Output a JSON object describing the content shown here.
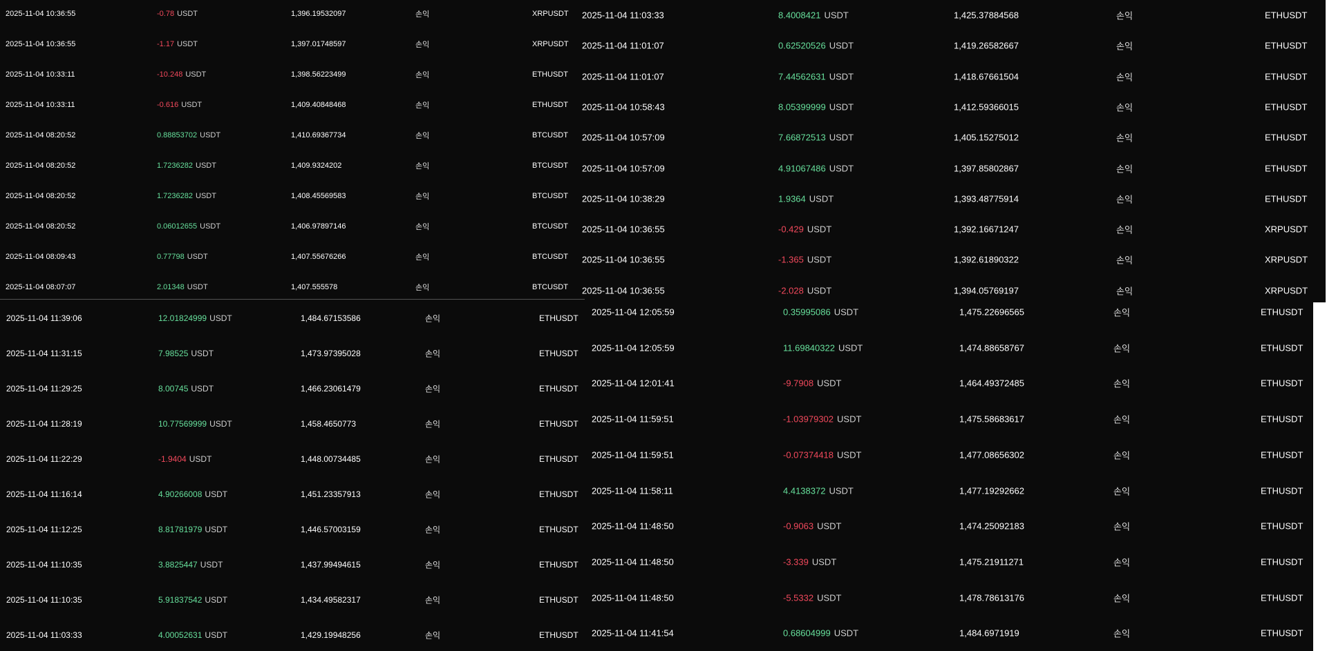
{
  "colors": {
    "background": "#0b0b0b",
    "profit": "#67e09c",
    "loss": "#f2495c",
    "text": "#ffffff"
  },
  "panels": [
    {
      "id": "top-left",
      "rows": [
        {
          "time": "2025-11-04 10:36:55",
          "amount": "-0.78",
          "unit": "USDT",
          "price": "1,396.19532097",
          "type": "손익",
          "symbol": "XRPUSDT"
        },
        {
          "time": "2025-11-04 10:36:55",
          "amount": "-1.17",
          "unit": "USDT",
          "price": "1,397.01748597",
          "type": "손익",
          "symbol": "XRPUSDT"
        },
        {
          "time": "2025-11-04 10:33:11",
          "amount": "-10.248",
          "unit": "USDT",
          "price": "1,398.56223499",
          "type": "손익",
          "symbol": "ETHUSDT"
        },
        {
          "time": "2025-11-04 10:33:11",
          "amount": "-0.616",
          "unit": "USDT",
          "price": "1,409.40848468",
          "type": "손익",
          "symbol": "ETHUSDT"
        },
        {
          "time": "2025-11-04 08:20:52",
          "amount": "0.88853702",
          "unit": "USDT",
          "price": "1,410.69367734",
          "type": "손익",
          "symbol": "BTCUSDT"
        },
        {
          "time": "2025-11-04 08:20:52",
          "amount": "1.7236282",
          "unit": "USDT",
          "price": "1,409.9324202",
          "type": "손익",
          "symbol": "BTCUSDT"
        },
        {
          "time": "2025-11-04 08:20:52",
          "amount": "1.7236282",
          "unit": "USDT",
          "price": "1,408.45569583",
          "type": "손익",
          "symbol": "BTCUSDT"
        },
        {
          "time": "2025-11-04 08:20:52",
          "amount": "0.06012655",
          "unit": "USDT",
          "price": "1,406.97897146",
          "type": "손익",
          "symbol": "BTCUSDT"
        },
        {
          "time": "2025-11-04 08:09:43",
          "amount": "0.77798",
          "unit": "USDT",
          "price": "1,407.55676266",
          "type": "손익",
          "symbol": "BTCUSDT"
        },
        {
          "time": "2025-11-04 08:07:07",
          "amount": "2.01348",
          "unit": "USDT",
          "price": "1,407.555578",
          "type": "손익",
          "symbol": "BTCUSDT"
        }
      ]
    },
    {
      "id": "top-right",
      "rows": [
        {
          "time": "2025-11-04 11:03:33",
          "amount": "8.4008421",
          "unit": "USDT",
          "price": "1,425.37884568",
          "type": "손익",
          "symbol": "ETHUSDT"
        },
        {
          "time": "2025-11-04 11:01:07",
          "amount": "0.62520526",
          "unit": "USDT",
          "price": "1,419.26582667",
          "type": "손익",
          "symbol": "ETHUSDT"
        },
        {
          "time": "2025-11-04 11:01:07",
          "amount": "7.44562631",
          "unit": "USDT",
          "price": "1,418.67661504",
          "type": "손익",
          "symbol": "ETHUSDT"
        },
        {
          "time": "2025-11-04 10:58:43",
          "amount": "8.05399999",
          "unit": "USDT",
          "price": "1,412.59366015",
          "type": "손익",
          "symbol": "ETHUSDT"
        },
        {
          "time": "2025-11-04 10:57:09",
          "amount": "7.66872513",
          "unit": "USDT",
          "price": "1,405.15275012",
          "type": "손익",
          "symbol": "ETHUSDT"
        },
        {
          "time": "2025-11-04 10:57:09",
          "amount": "4.91067486",
          "unit": "USDT",
          "price": "1,397.85802867",
          "type": "손익",
          "symbol": "ETHUSDT"
        },
        {
          "time": "2025-11-04 10:38:29",
          "amount": "1.9364",
          "unit": "USDT",
          "price": "1,393.48775914",
          "type": "손익",
          "symbol": "ETHUSDT"
        },
        {
          "time": "2025-11-04 10:36:55",
          "amount": "-0.429",
          "unit": "USDT",
          "price": "1,392.16671247",
          "type": "손익",
          "symbol": "XRPUSDT"
        },
        {
          "time": "2025-11-04 10:36:55",
          "amount": "-1.365",
          "unit": "USDT",
          "price": "1,392.61890322",
          "type": "손익",
          "symbol": "XRPUSDT"
        },
        {
          "time": "2025-11-04 10:36:55",
          "amount": "-2.028",
          "unit": "USDT",
          "price": "1,394.05769197",
          "type": "손익",
          "symbol": "XRPUSDT"
        }
      ]
    },
    {
      "id": "bottom-left",
      "rows": [
        {
          "time": "2025-11-04 11:39:06",
          "amount": "12.01824999",
          "unit": "USDT",
          "price": "1,484.67153586",
          "type": "손익",
          "symbol": "ETHUSDT"
        },
        {
          "time": "2025-11-04 11:31:15",
          "amount": "7.98525",
          "unit": "USDT",
          "price": "1,473.97395028",
          "type": "손익",
          "symbol": "ETHUSDT"
        },
        {
          "time": "2025-11-04 11:29:25",
          "amount": "8.00745",
          "unit": "USDT",
          "price": "1,466.23061479",
          "type": "손익",
          "symbol": "ETHUSDT"
        },
        {
          "time": "2025-11-04 11:28:19",
          "amount": "10.77569999",
          "unit": "USDT",
          "price": "1,458.4650773",
          "type": "손익",
          "symbol": "ETHUSDT"
        },
        {
          "time": "2025-11-04 11:22:29",
          "amount": "-1.9404",
          "unit": "USDT",
          "price": "1,448.00734485",
          "type": "손익",
          "symbol": "ETHUSDT"
        },
        {
          "time": "2025-11-04 11:16:14",
          "amount": "4.90266008",
          "unit": "USDT",
          "price": "1,451.23357913",
          "type": "손익",
          "symbol": "ETHUSDT"
        },
        {
          "time": "2025-11-04 11:12:25",
          "amount": "8.81781979",
          "unit": "USDT",
          "price": "1,446.57003159",
          "type": "손익",
          "symbol": "ETHUSDT"
        },
        {
          "time": "2025-11-04 11:10:35",
          "amount": "3.8825447",
          "unit": "USDT",
          "price": "1,437.99494615",
          "type": "손익",
          "symbol": "ETHUSDT"
        },
        {
          "time": "2025-11-04 11:10:35",
          "amount": "5.91837542",
          "unit": "USDT",
          "price": "1,434.49582317",
          "type": "손익",
          "symbol": "ETHUSDT"
        },
        {
          "time": "2025-11-04 11:03:33",
          "amount": "4.00052631",
          "unit": "USDT",
          "price": "1,429.19948256",
          "type": "손익",
          "symbol": "ETHUSDT"
        }
      ]
    },
    {
      "id": "bottom-right",
      "rows": [
        {
          "time": "2025-11-04 12:05:59",
          "amount": "0.35995086",
          "unit": "USDT",
          "price": "1,475.22696565",
          "type": "손익",
          "symbol": "ETHUSDT"
        },
        {
          "time": "2025-11-04 12:05:59",
          "amount": "11.69840322",
          "unit": "USDT",
          "price": "1,474.88658767",
          "type": "손익",
          "symbol": "ETHUSDT"
        },
        {
          "time": "2025-11-04 12:01:41",
          "amount": "-9.7908",
          "unit": "USDT",
          "price": "1,464.49372485",
          "type": "손익",
          "symbol": "ETHUSDT"
        },
        {
          "time": "2025-11-04 11:59:51",
          "amount": "-1.03979302",
          "unit": "USDT",
          "price": "1,475.58683617",
          "type": "손익",
          "symbol": "ETHUSDT"
        },
        {
          "time": "2025-11-04 11:59:51",
          "amount": "-0.07374418",
          "unit": "USDT",
          "price": "1,477.08656302",
          "type": "손익",
          "symbol": "ETHUSDT"
        },
        {
          "time": "2025-11-04 11:58:11",
          "amount": "4.4138372",
          "unit": "USDT",
          "price": "1,477.19292662",
          "type": "손익",
          "symbol": "ETHUSDT"
        },
        {
          "time": "2025-11-04 11:48:50",
          "amount": "-0.9063",
          "unit": "USDT",
          "price": "1,474.25092183",
          "type": "손익",
          "symbol": "ETHUSDT"
        },
        {
          "time": "2025-11-04 11:48:50",
          "amount": "-3.339",
          "unit": "USDT",
          "price": "1,475.21911271",
          "type": "손익",
          "symbol": "ETHUSDT"
        },
        {
          "time": "2025-11-04 11:48:50",
          "amount": "-5.5332",
          "unit": "USDT",
          "price": "1,478.78613176",
          "type": "손익",
          "symbol": "ETHUSDT"
        },
        {
          "time": "2025-11-04 11:41:54",
          "amount": "0.68604999",
          "unit": "USDT",
          "price": "1,484.6971919",
          "type": "손익",
          "symbol": "ETHUSDT"
        }
      ]
    }
  ]
}
